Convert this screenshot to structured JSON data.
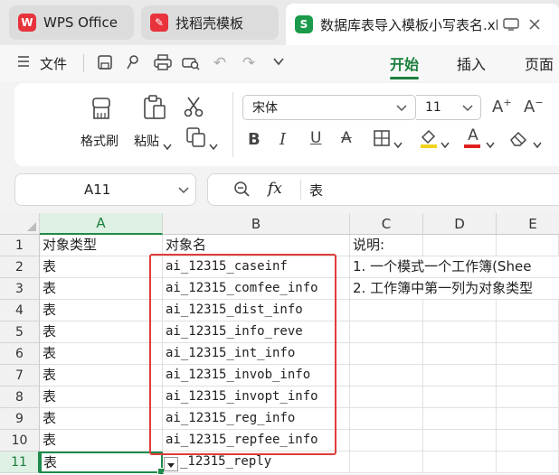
{
  "tabs": [
    {
      "label": "WPS Office",
      "icon": "wps-logo-icon",
      "color": "#e8323c"
    },
    {
      "label": "找稻壳模板",
      "icon": "docer-icon",
      "color": "#e8323c"
    },
    {
      "label": "数据库表导入模板小写表名.xl",
      "icon": "spreadsheet-s-icon",
      "color": "#1a9a4a"
    }
  ],
  "menu": {
    "file_label": "文件"
  },
  "ribbon_tabs": [
    "开始",
    "插入",
    "页面"
  ],
  "ribbon": {
    "format_painter": "格式刷",
    "paste": "粘贴",
    "font_name": "宋体",
    "font_size": "11"
  },
  "formula_bar": {
    "cell_ref": "A11",
    "fx": "fx",
    "value": "表"
  },
  "columns": [
    "A",
    "B",
    "C",
    "D",
    "E"
  ],
  "rows": [
    "1",
    "2",
    "3",
    "4",
    "5",
    "6",
    "7",
    "8",
    "9",
    "10",
    "11"
  ],
  "cells": {
    "a": [
      "对象类型",
      "表",
      "表",
      "表",
      "表",
      "表",
      "表",
      "表",
      "表",
      "表",
      "表"
    ],
    "b": [
      "对象名",
      "ai_12315_caseinf",
      "ai_12315_comfee_info",
      "ai_12315_dist_info",
      "ai_12315_info_reve",
      "ai_12315_int_info",
      "ai_12315_invob_info",
      "ai_12315_invopt_info",
      "ai_12315_reg_info",
      "ai_12315_repfee_info",
      "_12315_reply"
    ],
    "c": [
      "说明:",
      "1.  一个模式一个工作簿(Shee",
      "2.  工作簿中第一列为对象类型"
    ]
  },
  "colors": {
    "accent": "#1a7f3c",
    "highlight_box": "#e03c3c",
    "selected_cell": "#1e8a4b"
  }
}
